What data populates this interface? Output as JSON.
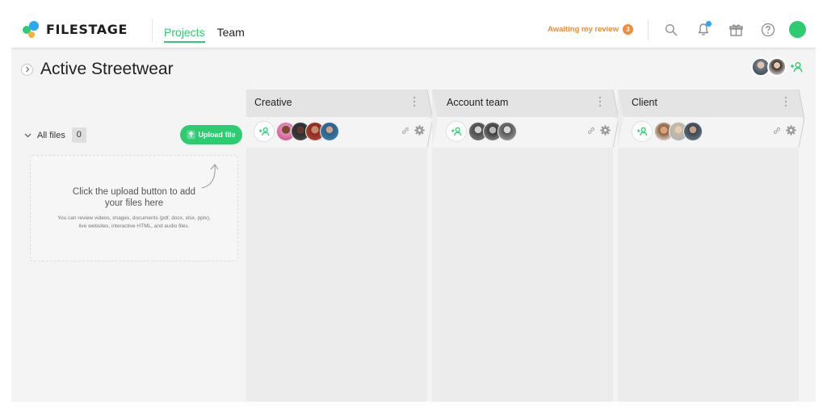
{
  "brand": {
    "name": "FILESTAGE",
    "colors": {
      "accent_green": "#2ecc71",
      "accent_blue": "#2aa8f2",
      "accent_yellow": "#f5b335",
      "review_orange": "#f08c3a"
    }
  },
  "nav": {
    "tabs": [
      {
        "label": "Projects",
        "active": true
      },
      {
        "label": "Team",
        "active": false
      }
    ],
    "awaiting": {
      "label": "Awaiting my review",
      "count": "3"
    },
    "icons": [
      "search-icon",
      "bell-icon",
      "gift-icon",
      "help-icon",
      "user-avatar"
    ]
  },
  "project": {
    "title": "Active Streetwear",
    "member_count": 2
  },
  "files": {
    "label": "All files",
    "count": "0",
    "upload_label": "Upload file",
    "empty_title": "Click the upload button to add your files here",
    "empty_desc": "You can review videos, images, documents (pdf, docx, xlsx, pptx), live websites, interactive HTML, and audio files."
  },
  "steps": [
    {
      "name": "Creative",
      "reviewer_count": 4
    },
    {
      "name": "Account team",
      "reviewer_count": 3
    },
    {
      "name": "Client",
      "reviewer_count": 3
    }
  ]
}
